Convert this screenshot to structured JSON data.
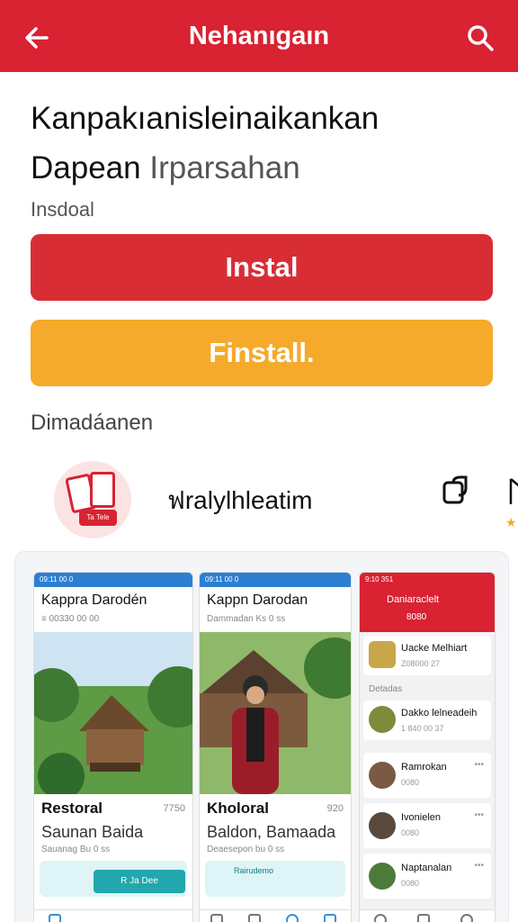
{
  "header": {
    "title": "Nehanıgaın",
    "back_icon": "back-arrow-icon",
    "search_icon": "search-icon",
    "color": "#d92232"
  },
  "app": {
    "title": "Kanpakıanisleinaikankan",
    "developer": "Dapean",
    "category": "Irparsahan",
    "install_note": "Insdoal"
  },
  "buttons": {
    "install_primary": "Instal",
    "install_secondary": "Finstall."
  },
  "related": {
    "section_label": "Dimadáanen",
    "app_name": "ฟralylhleatim",
    "tag": "Ta Tele"
  },
  "screenshots": [
    {
      "status": "09:11 00 0",
      "title": "Kappra Darodén",
      "meta": "≡ 00330 00 00",
      "heading": "Restoral",
      "right": "7750",
      "desc": "Saunan Baida",
      "tiny": "Sauanag Bu 0 ss",
      "cta": "R Ja Dee"
    },
    {
      "status": "09:11 00 0",
      "title": "Kappn Darodan",
      "meta": "Dammadan  Ks 0 ss",
      "heading": "Kholoral",
      "right": "920",
      "desc": "Baldon, Bamaada",
      "tiny": "Deaesepon bu 0 ss",
      "cta": "Rairudemo"
    },
    {
      "status": "9:10 351",
      "header_title": "Daniaraclelt",
      "header_sub": "8080",
      "rows": [
        {
          "name": "Uacke Melhiart",
          "sub": "Z08000 27"
        },
        {
          "name": "Dakko lelneadeih",
          "sub": "1 840 00 37"
        },
        {
          "name": "Ramrokan",
          "sub": "0080"
        },
        {
          "name": "Ivonielen",
          "sub": "0080"
        },
        {
          "name": "Naptanalan",
          "sub": "0080"
        }
      ],
      "section": "Detadas"
    }
  ]
}
